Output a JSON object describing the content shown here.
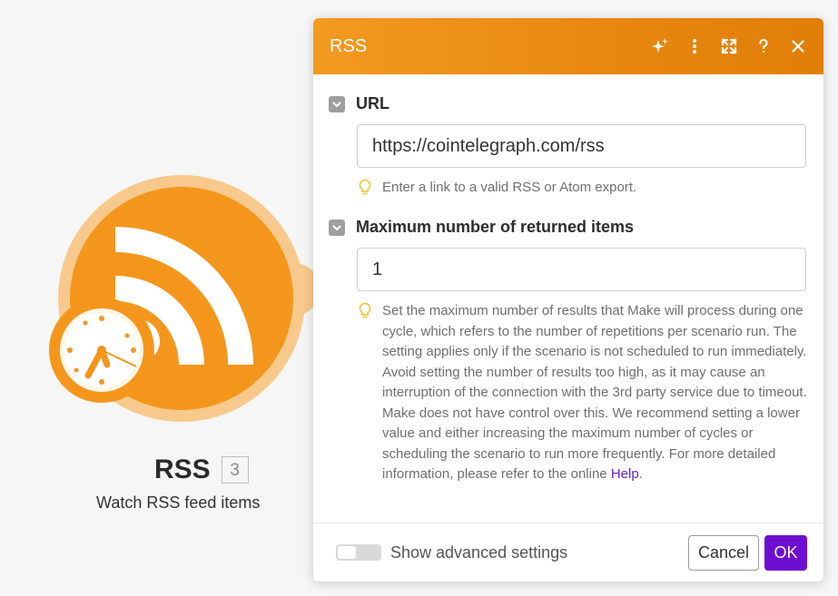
{
  "module": {
    "title": "RSS",
    "index": "3",
    "subtitle": "Watch RSS feed items"
  },
  "dialog": {
    "title": "RSS",
    "header_icons": [
      "sparkle-icon",
      "more-vertical-icon",
      "expand-icon",
      "help-icon",
      "close-icon"
    ],
    "fields": {
      "url": {
        "label": "URL",
        "value": "https://cointelegraph.com/rss",
        "hint": "Enter a link to a valid RSS or Atom export."
      },
      "max_items": {
        "label": "Maximum number of returned items",
        "value": "1",
        "hint": "Set the maximum number of results that Make will process during one cycle, which refers to the number of repetitions per scenario run. The setting applies only if the scenario is not scheduled to run immediately. Avoid setting the number of results too high, as it may cause an interruption of the connection with the 3rd party service due to timeout. Make does not have control over this. We recommend setting a lower value and either increasing the maximum number of cycles or scheduling the scenario to run more frequently. For more detailed information, please refer to the online ",
        "hint_link": "Help",
        "hint_end": "."
      }
    },
    "footer": {
      "advanced_toggle_label": "Show advanced settings",
      "advanced_enabled": false,
      "cancel_label": "Cancel",
      "ok_label": "OK"
    }
  },
  "colors": {
    "brand_orange": "#f5961c",
    "header_orange": "#e8870f",
    "primary_purple": "#6d0fd0",
    "link_purple": "#6b1fc7"
  }
}
